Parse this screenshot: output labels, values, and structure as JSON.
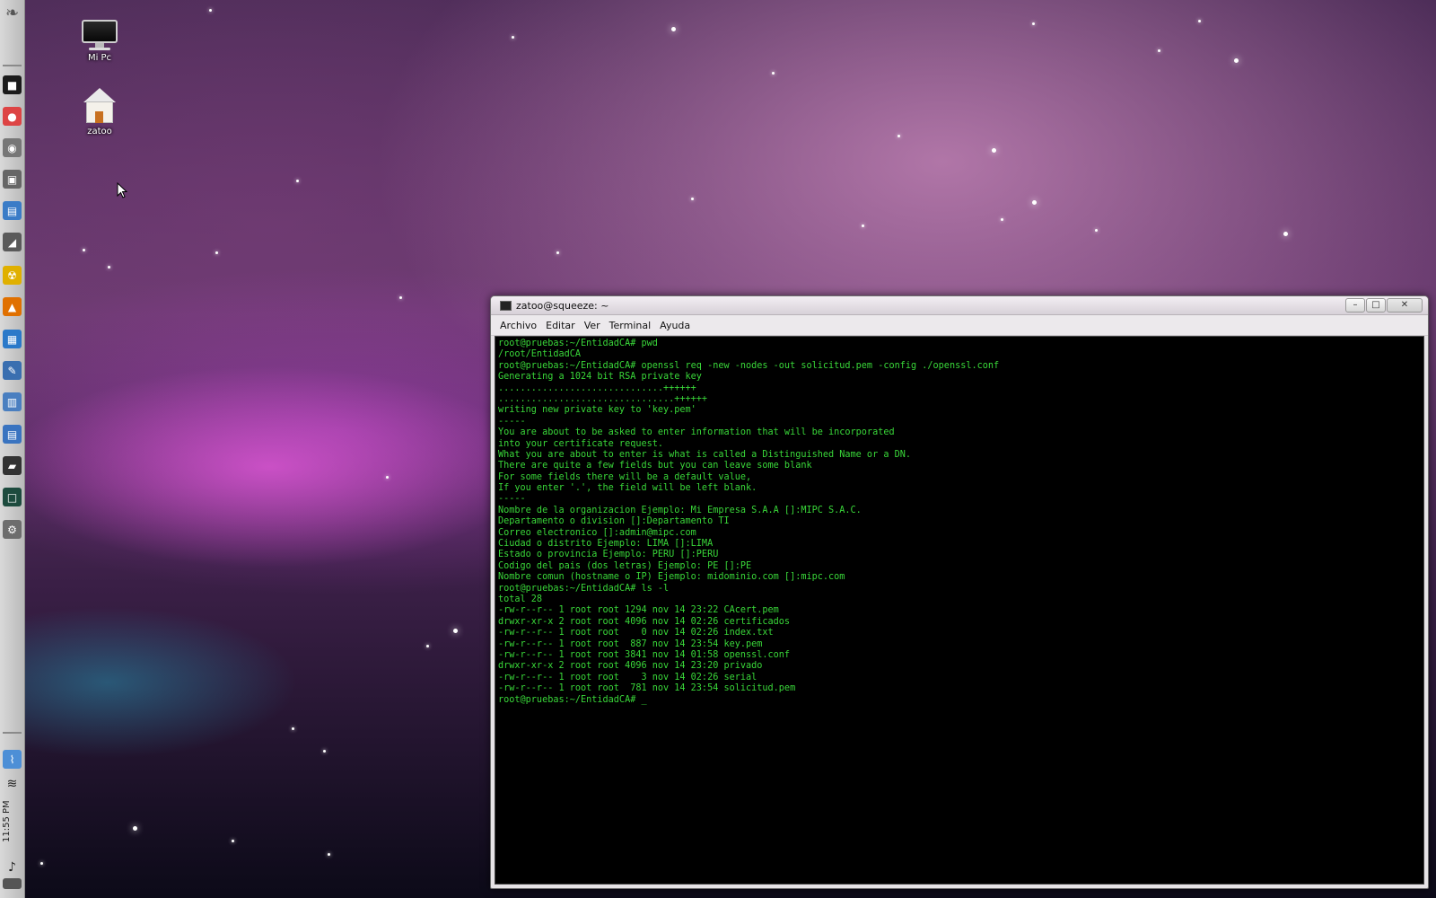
{
  "desktop": {
    "icons": [
      {
        "label": "Mi Pc",
        "icon": "monitor-icon"
      },
      {
        "label": "zatoo",
        "icon": "home-icon"
      }
    ]
  },
  "dock": {
    "items": [
      {
        "name": "gnome-foot-icon",
        "glyph": "❧"
      },
      {
        "name": "terminal-icon",
        "glyph": "■"
      },
      {
        "name": "chrome-icon",
        "glyph": "●"
      },
      {
        "name": "system-disc-icon",
        "glyph": "◉"
      },
      {
        "name": "cube-icon",
        "glyph": "▣"
      },
      {
        "name": "document-icon",
        "glyph": "▤"
      },
      {
        "name": "drawing-icon",
        "glyph": "◢"
      },
      {
        "name": "radiation-icon",
        "glyph": "☢"
      },
      {
        "name": "vlc-icon",
        "glyph": "▲"
      },
      {
        "name": "presentation-icon",
        "glyph": "▦"
      },
      {
        "name": "pen-icon",
        "glyph": "✎"
      },
      {
        "name": "spreadsheet-icon",
        "glyph": "▥"
      },
      {
        "name": "writer-icon",
        "glyph": "▤"
      },
      {
        "name": "eraser-icon",
        "glyph": "▰"
      },
      {
        "name": "monitor-graph-icon",
        "glyph": "□"
      },
      {
        "name": "settings-icon",
        "glyph": "⚙"
      }
    ],
    "tray": {
      "network_icon": "wifi-icon",
      "clock": "11:55 PM",
      "volume_icon": "speaker-icon"
    }
  },
  "window": {
    "title": "zatoo@squeeze: ~",
    "buttons": {
      "minimize": "–",
      "maximize": "□",
      "close": "✕"
    },
    "menu": [
      "Archivo",
      "Editar",
      "Ver",
      "Terminal",
      "Ayuda"
    ],
    "terminal_lines": [
      "root@pruebas:~/EntidadCA# pwd",
      "/root/EntidadCA",
      "root@pruebas:~/EntidadCA# openssl req -new -nodes -out solicitud.pem -config ./openssl.conf",
      "Generating a 1024 bit RSA private key",
      "..............................++++++",
      "................................++++++",
      "writing new private key to 'key.pem'",
      "-----",
      "You are about to be asked to enter information that will be incorporated",
      "into your certificate request.",
      "What you are about to enter is what is called a Distinguished Name or a DN.",
      "There are quite a few fields but you can leave some blank",
      "For some fields there will be a default value,",
      "If you enter '.', the field will be left blank.",
      "-----",
      "Nombre de la organizacion Ejemplo: Mi Empresa S.A.A []:MIPC S.A.C.",
      "Departamento o division []:Departamento TI",
      "Correo electronico []:admin@mipc.com",
      "Ciudad o distrito Ejemplo: LIMA []:LIMA",
      "Estado o provincia Ejemplo: PERU []:PERU",
      "Codigo del pais (dos letras) Ejemplo: PE []:PE",
      "Nombre comun (hostname o IP) Ejemplo: midominio.com []:mipc.com",
      "root@pruebas:~/EntidadCA# ls -l",
      "total 28",
      "-rw-r--r-- 1 root root 1294 nov 14 23:22 CAcert.pem",
      "drwxr-xr-x 2 root root 4096 nov 14 02:26 certificados",
      "-rw-r--r-- 1 root root    0 nov 14 02:26 index.txt",
      "-rw-r--r-- 1 root root  887 nov 14 23:54 key.pem",
      "-rw-r--r-- 1 root root 3841 nov 14 01:58 openssl.conf",
      "drwxr-xr-x 2 root root 4096 nov 14 23:20 privado",
      "-rw-r--r-- 1 root root    3 nov 14 02:26 serial",
      "-rw-r--r-- 1 root root  781 nov 14 23:54 solicitud.pem",
      "root@pruebas:~/EntidadCA# _"
    ]
  }
}
